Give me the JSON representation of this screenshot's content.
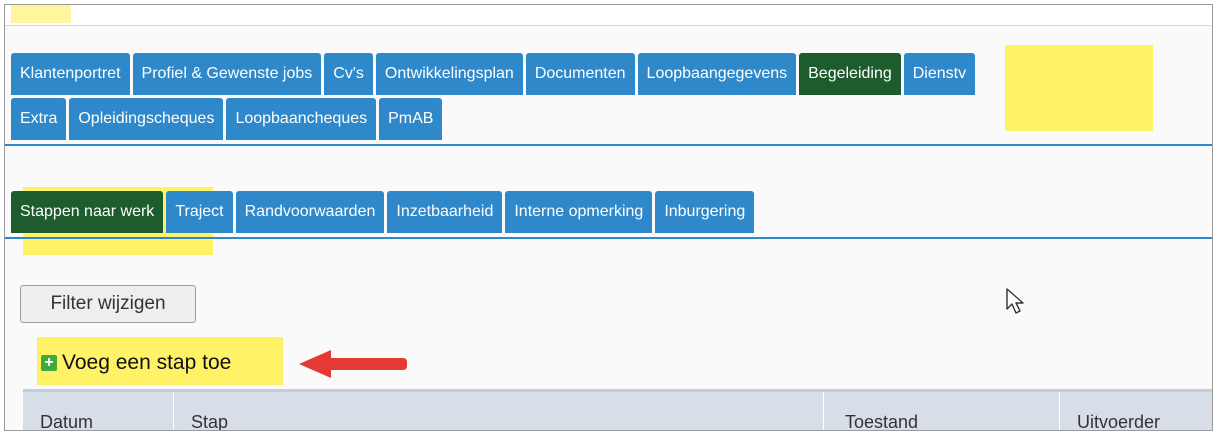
{
  "main_tabs_row1": [
    {
      "label": "Klantenportret",
      "active": false
    },
    {
      "label": "Profiel & Gewenste jobs",
      "active": false
    },
    {
      "label": "Cv's",
      "active": false
    },
    {
      "label": "Ontwikkelingsplan",
      "active": false
    },
    {
      "label": "Documenten",
      "active": false
    },
    {
      "label": "Loopbaangegevens",
      "active": false
    },
    {
      "label": "Begeleiding",
      "active": true
    },
    {
      "label": "Dienstv",
      "active": false
    }
  ],
  "main_tabs_row2": [
    {
      "label": "Extra"
    },
    {
      "label": "Opleidingscheques"
    },
    {
      "label": "Loopbaancheques"
    },
    {
      "label": "PmAB"
    }
  ],
  "sub_tabs": [
    {
      "label": "Stappen naar werk",
      "active": true
    },
    {
      "label": "Traject",
      "active": false
    },
    {
      "label": "Randvoorwaarden",
      "active": false
    },
    {
      "label": "Inzetbaarheid",
      "active": false
    },
    {
      "label": "Interne opmerking",
      "active": false
    },
    {
      "label": "Inburgering",
      "active": false
    }
  ],
  "filter_button": "Filter wijzigen",
  "add_step": {
    "icon": "+",
    "label": "Voeg een stap toe"
  },
  "table": {
    "columns": [
      "Datum",
      "Stap",
      "Toestand",
      "Uitvoerder"
    ]
  },
  "colors": {
    "tab": "#2e88c9",
    "tab_active": "#1e5b2d",
    "highlight": "#fff267",
    "arrow": "#e53935",
    "header_bg": "#d7dee8"
  }
}
